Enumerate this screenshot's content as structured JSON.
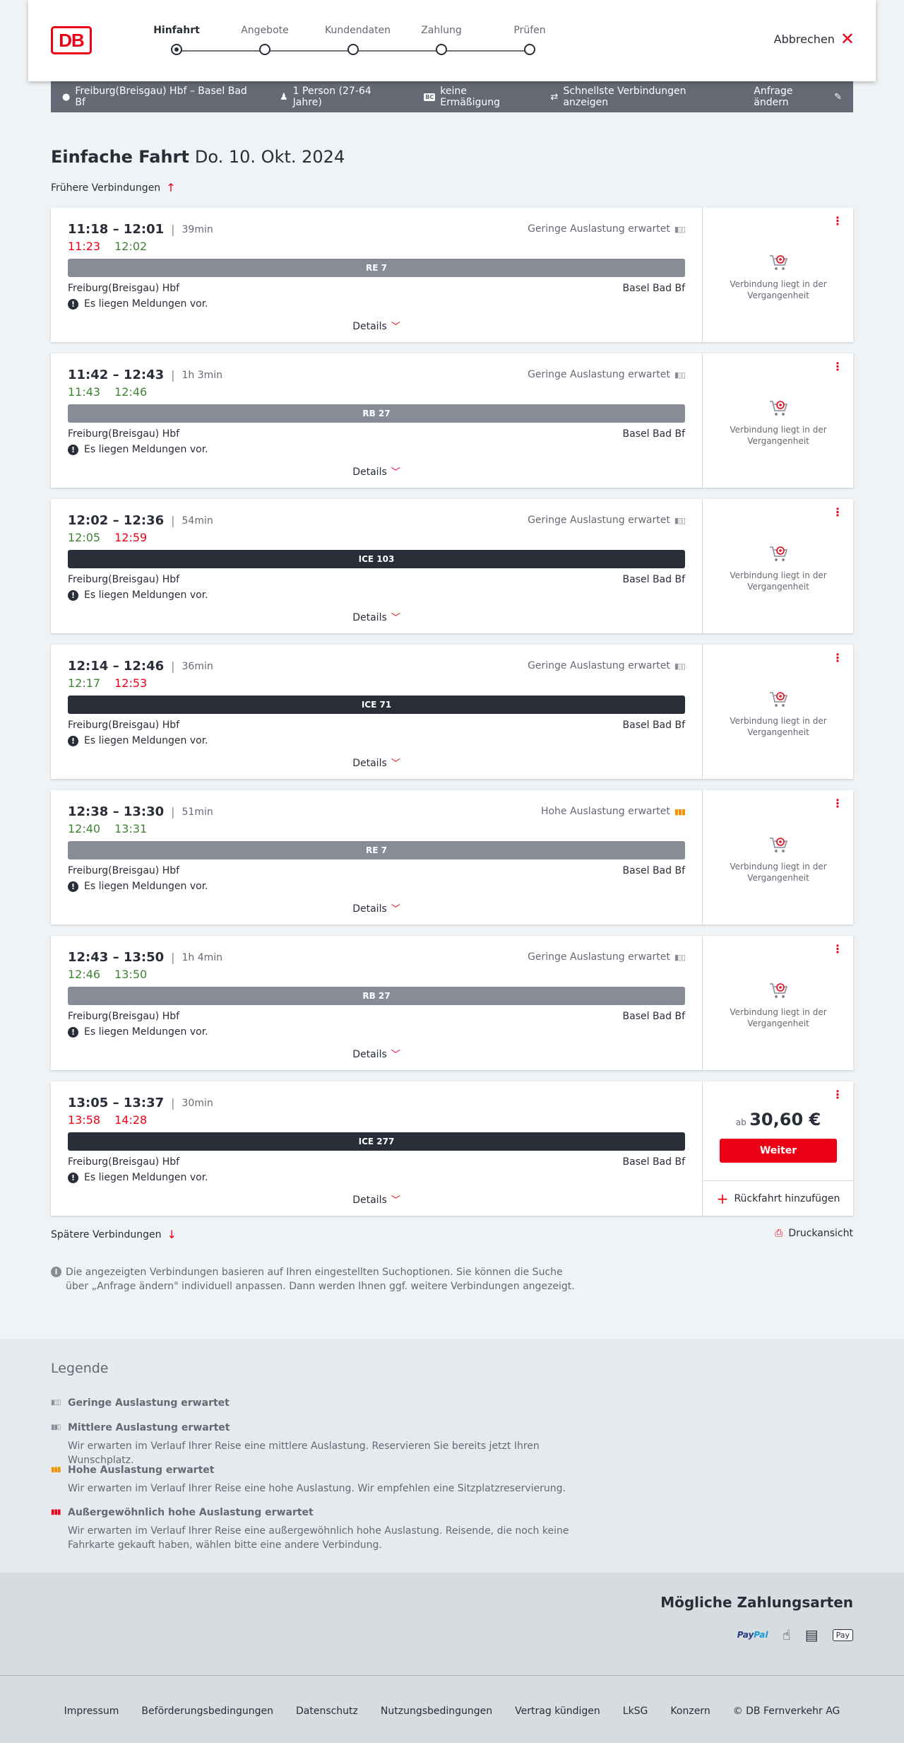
{
  "header": {
    "logo_text": "DB",
    "steps": [
      "Hinfahrt",
      "Angebote",
      "Kundendaten",
      "Zahlung",
      "Prüfen"
    ],
    "active_step": 0,
    "cancel_label": "Abbrechen"
  },
  "search": {
    "route": "Freiburg(Breisgau) Hbf – Basel Bad Bf",
    "passengers": "1 Person (27-64 Jahre)",
    "bc_badge": "BC",
    "discount": "keine Ermäßigung",
    "fastest": "Schnellste Verbindungen anzeigen",
    "change": "Anfrage ändern"
  },
  "page": {
    "title": "Einfache Fahrt",
    "date": "Do. 10. Okt. 2024",
    "earlier": "Frühere Verbindungen",
    "later": "Spätere Verbindungen",
    "print": "Druckansicht",
    "info": "Die angezeigten Verbindungen basieren auf Ihren eingestellten Suchoptionen. Sie können die Suche über „Anfrage ändern\" individuell anpassen. Dann werden Ihnen ggf. weitere Verbindungen angezeigt."
  },
  "connections": [
    {
      "planned": "11:18 – 12:01",
      "duration": "39min",
      "rt_dep": "11:23",
      "rt_dep_status": "red",
      "rt_arr": "12:02",
      "rt_arr_status": "green",
      "load": "Geringe Auslastung erwartet",
      "load_level": "low",
      "train": "RE 7",
      "train_style": "grey",
      "from": "Freiburg(Breisgau) Hbf",
      "to": "Basel Bad Bf",
      "message": "Es liegen Meldungen vor.",
      "details": "Details",
      "state": "past",
      "past_text": "Verbindung liegt in der Vergangenheit"
    },
    {
      "planned": "11:42 – 12:43",
      "duration": "1h 3min",
      "rt_dep": "11:43",
      "rt_dep_status": "green",
      "rt_arr": "12:46",
      "rt_arr_status": "green",
      "load": "Geringe Auslastung erwartet",
      "load_level": "low",
      "train": "RB 27",
      "train_style": "grey",
      "from": "Freiburg(Breisgau) Hbf",
      "to": "Basel Bad Bf",
      "message": "Es liegen Meldungen vor.",
      "details": "Details",
      "state": "past",
      "past_text": "Verbindung liegt in der Vergangenheit"
    },
    {
      "planned": "12:02 – 12:36",
      "duration": "54min",
      "rt_dep": "12:05",
      "rt_dep_status": "green",
      "rt_arr": "12:59",
      "rt_arr_status": "red",
      "load": "Geringe Auslastung erwartet",
      "load_level": "low",
      "train": "ICE 103",
      "train_style": "dark",
      "from": "Freiburg(Breisgau) Hbf",
      "to": "Basel Bad Bf",
      "message": "Es liegen Meldungen vor.",
      "details": "Details",
      "state": "past",
      "past_text": "Verbindung liegt in der Vergangenheit"
    },
    {
      "planned": "12:14 – 12:46",
      "duration": "36min",
      "rt_dep": "12:17",
      "rt_dep_status": "green",
      "rt_arr": "12:53",
      "rt_arr_status": "red",
      "load": "Geringe Auslastung erwartet",
      "load_level": "low",
      "train": "ICE 71",
      "train_style": "dark",
      "from": "Freiburg(Breisgau) Hbf",
      "to": "Basel Bad Bf",
      "message": "Es liegen Meldungen vor.",
      "details": "Details",
      "state": "past",
      "past_text": "Verbindung liegt in der Vergangenheit"
    },
    {
      "planned": "12:38 – 13:30",
      "duration": "51min",
      "rt_dep": "12:40",
      "rt_dep_status": "green",
      "rt_arr": "13:31",
      "rt_arr_status": "green",
      "load": "Hohe Auslastung erwartet",
      "load_level": "high",
      "train": "RE 7",
      "train_style": "grey",
      "from": "Freiburg(Breisgau) Hbf",
      "to": "Basel Bad Bf",
      "message": "Es liegen Meldungen vor.",
      "details": "Details",
      "state": "past",
      "past_text": "Verbindung liegt in der Vergangenheit"
    },
    {
      "planned": "12:43 – 13:50",
      "duration": "1h 4min",
      "rt_dep": "12:46",
      "rt_dep_status": "green",
      "rt_arr": "13:50",
      "rt_arr_status": "green",
      "load": "Geringe Auslastung erwartet",
      "load_level": "low",
      "train": "RB 27",
      "train_style": "grey",
      "from": "Freiburg(Breisgau) Hbf",
      "to": "Basel Bad Bf",
      "message": "Es liegen Meldungen vor.",
      "details": "Details",
      "state": "past",
      "past_text": "Verbindung liegt in der Vergangenheit"
    },
    {
      "planned": "13:05 – 13:37",
      "duration": "30min",
      "rt_dep": "13:58",
      "rt_dep_status": "red",
      "rt_arr": "14:28",
      "rt_arr_status": "red",
      "load": "",
      "load_level": "none",
      "train": "ICE 277",
      "train_style": "dark",
      "from": "Freiburg(Breisgau) Hbf",
      "to": "Basel Bad Bf",
      "message": "Es liegen Meldungen vor.",
      "details": "Details",
      "state": "bookable",
      "price_prefix": "ab",
      "price": "30,60 €",
      "button": "Weiter",
      "return": "Rückfahrt hinzufügen"
    }
  ],
  "legend": {
    "title": "Legende",
    "items": [
      {
        "title": "Geringe Auslastung erwartet",
        "desc": "",
        "level": "low"
      },
      {
        "title": "Mittlere Auslastung erwartet",
        "desc": "Wir erwarten im Verlauf Ihrer Reise eine mittlere Auslastung. Reservieren Sie bereits jetzt Ihren Wunschplatz.",
        "level": "mid"
      },
      {
        "title": "Hohe Auslastung erwartet",
        "desc": "Wir erwarten im Verlauf Ihrer Reise eine hohe Auslastung. Wir empfehlen eine Sitzplatzreservierung.",
        "level": "high"
      },
      {
        "title": "Außergewöhnlich hohe Auslastung erwartet",
        "desc": "Wir erwarten im Verlauf Ihrer Reise eine außergewöhnlich hohe Auslastung. Reisende, die noch keine Fahrkarte gekauft haben, wählen bitte eine andere Verbindung.",
        "level": "extreme"
      }
    ]
  },
  "payment": {
    "title": "Mögliche Zahlungsarten",
    "methods": [
      "paypal-icon",
      "creditcard-icon",
      "sepa-icon",
      "applepay-icon"
    ],
    "paypal_pay": "Pay",
    "paypal_pal": "Pal",
    "applepay_label": " Pay"
  },
  "footer": {
    "links": [
      "Impressum",
      "Beförderungsbedingungen",
      "Datenschutz",
      "Nutzungsbedingungen",
      "Vertrag kündigen",
      "LkSG",
      "Konzern",
      "© DB Fernverkehr AG"
    ]
  },
  "colors": {
    "accent": "#ec0016",
    "on_time": "#408335",
    "delayed": "#ec0016",
    "high_load": "#f39200",
    "dark_train": "#282d37",
    "grey_train": "#878c96"
  }
}
